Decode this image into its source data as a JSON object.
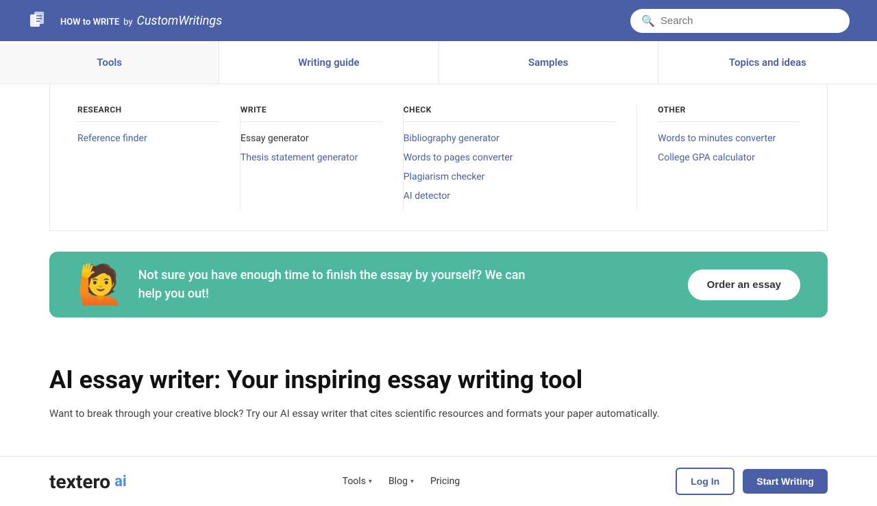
{
  "header": {
    "logo_text": "HOW to WRITE",
    "logo_by": "by",
    "logo_brand": "CustomWritings",
    "search_placeholder": "Search"
  },
  "nav": {
    "items": [
      {
        "label": "Tools",
        "active": true
      },
      {
        "label": "Writing guide",
        "active": false
      },
      {
        "label": "Samples",
        "active": false
      },
      {
        "label": "Topics and ideas",
        "active": false
      }
    ]
  },
  "dropdown": {
    "research": {
      "header": "RESEARCH",
      "links": [
        {
          "label": "Reference finder",
          "is_link": true
        }
      ]
    },
    "write": {
      "header": "WRITE",
      "items": [
        {
          "label": "Essay generator",
          "is_link": false
        },
        {
          "label": "Thesis statement generator",
          "is_link": true
        }
      ]
    },
    "check": {
      "header": "CHECK",
      "links": [
        {
          "label": "Bibliography generator"
        },
        {
          "label": "Words to pages converter"
        },
        {
          "label": "Plagiarism checker"
        },
        {
          "label": "AI detector"
        }
      ]
    },
    "other": {
      "header": "OTHER",
      "links": [
        {
          "label": "Words to minutes converter"
        },
        {
          "label": "College GPA calculator"
        }
      ]
    }
  },
  "banner": {
    "emoji": "🙋",
    "text": "Not sure you have enough time to finish the essay by yourself? We can help you out!",
    "button_label": "Order an essay"
  },
  "main": {
    "title": "AI essay writer: Your inspiring essay writing tool",
    "description": "Want to break through your creative block? Try our AI essay writer that cites scientific resources and formats your paper automatically."
  },
  "bottom": {
    "logo": "textero",
    "logo_ai": "ai",
    "nav_items": [
      {
        "label": "Tools",
        "has_chevron": true
      },
      {
        "label": "Blog",
        "has_chevron": true
      },
      {
        "label": "Pricing",
        "has_chevron": false
      }
    ],
    "btn_login": "Log In",
    "btn_start": "Start Writing"
  }
}
